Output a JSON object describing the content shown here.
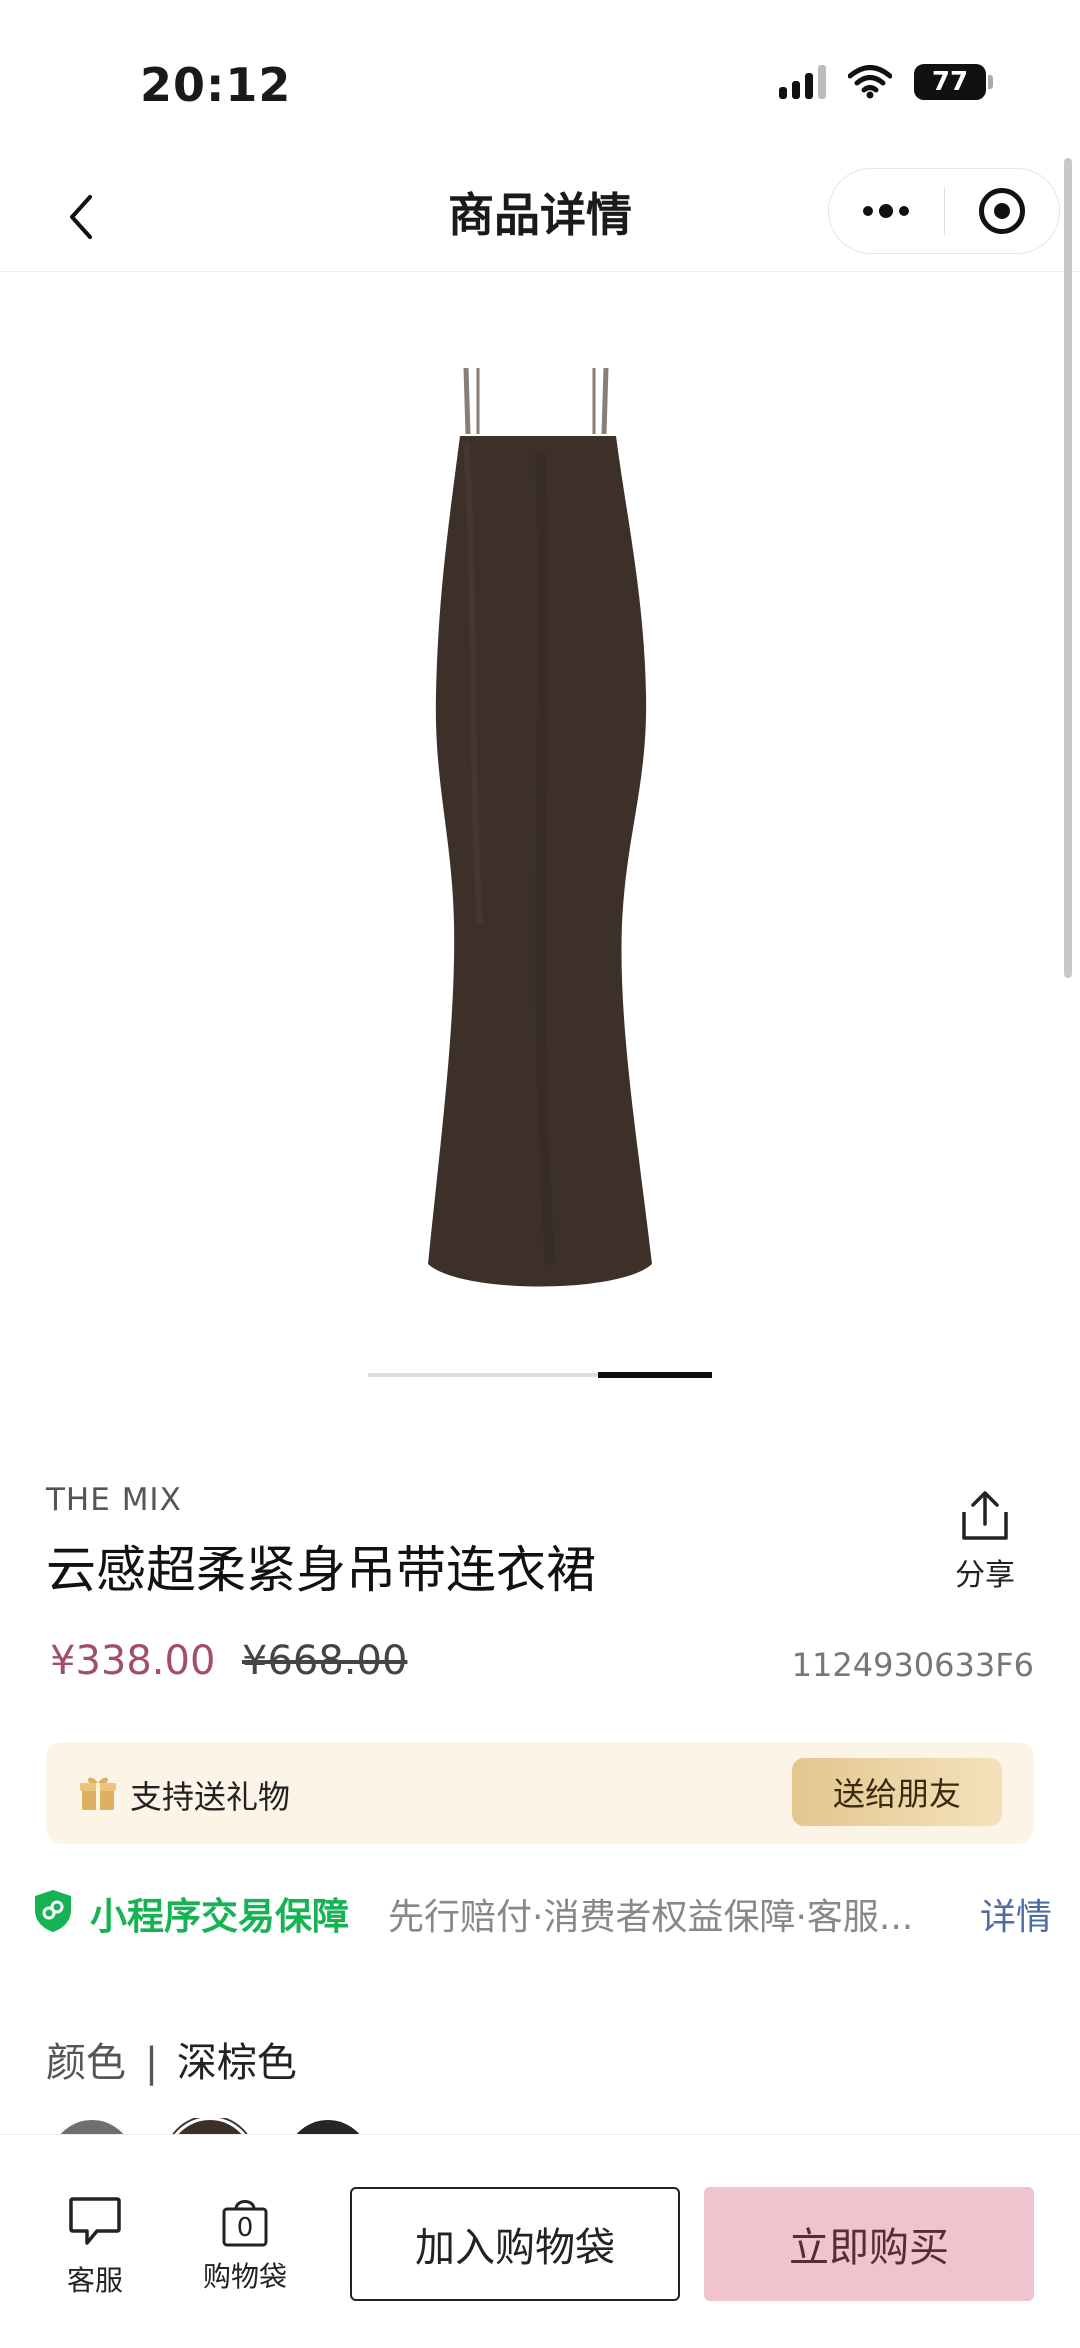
{
  "status_bar": {
    "time": "20:12",
    "battery": "77"
  },
  "nav": {
    "title": "商品详情",
    "back_icon": "chevron-left-icon",
    "more_icon": "more-dots-icon",
    "close_icon": "target-icon"
  },
  "gallery": {
    "image_alt": "dress-product-image",
    "active_page": 2,
    "total_pages": 2
  },
  "product": {
    "brand": "THE MIX",
    "title": "云感超柔紧身吊带连衣裙",
    "price": "¥338.00",
    "original_price": "¥668.00",
    "sku": "1124930633F6",
    "share_label": "分享"
  },
  "gift": {
    "text": "支持送礼物",
    "button": "送给朋友"
  },
  "guarantee": {
    "title": "小程序交易保障",
    "description": "先行赔付·消费者权益保障·客服...",
    "detail_link": "详情"
  },
  "color": {
    "label": "颜色",
    "separator": "|",
    "value": "深棕色",
    "swatches": [
      "#6f6f6f",
      "#3f2e26",
      "#262626"
    ]
  },
  "bottom_bar": {
    "service_label": "客服",
    "bag_label": "购物袋",
    "bag_count": "0",
    "add_to_bag": "加入购物袋",
    "buy_now": "立即购买"
  },
  "colors": {
    "price": "#a24d6c",
    "guarantee_green": "#16b355",
    "buy_now_bg": "#f0c4cf",
    "dress": "#3c3029"
  }
}
